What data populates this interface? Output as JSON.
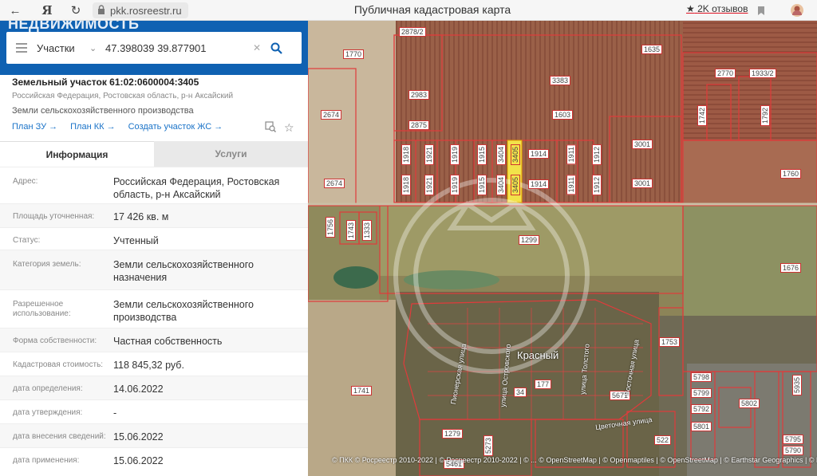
{
  "browser": {
    "url": "pkk.rosreestr.ru",
    "page_title": "Публичная кадастровая карта",
    "reviews": "2K отзывов"
  },
  "panel": {
    "brand": "НЕДВИЖИМОСТЬ",
    "search": {
      "type": "Участки",
      "query": "47.398039 39.877901"
    },
    "plot": {
      "title": "Земельный участок 61:02:0600004:3405",
      "address_short": "Российская Федерация, Ростовская область, р-н Аксайский",
      "category_short": "Земли сельскохозяйственного производства",
      "links": [
        "План ЗУ →",
        "План КК →",
        "Создать участок ЖС →"
      ]
    },
    "tabs": {
      "info": "Информация",
      "services": "Услуги"
    },
    "info": [
      {
        "label": "Адрес:",
        "value": "Российская Федерация, Ростовская область, р-н Аксайский"
      },
      {
        "label": "Площадь уточненная:",
        "value": "17 426 кв. м"
      },
      {
        "label": "Статус:",
        "value": "Учтенный"
      },
      {
        "label": "Категория земель:",
        "value": "Земли сельскохозяйственного назначения"
      },
      {
        "label": "Разрешенное использование:",
        "value": "Земли сельскохозяйственного производства"
      },
      {
        "label": "Форма собственности:",
        "value": "Частная собственность"
      },
      {
        "label": "Кадастровая стоимость:",
        "value": "118 845,32 руб."
      },
      {
        "label": "дата определения:",
        "value": "14.06.2022"
      },
      {
        "label": "дата утверждения:",
        "value": "-"
      },
      {
        "label": "дата внесения сведений:",
        "value": "15.06.2022"
      },
      {
        "label": "дата применения:",
        "value": "15.06.2022"
      }
    ]
  },
  "map": {
    "labels": [
      "2878/2",
      "1770",
      "1635",
      "3383",
      "2770",
      "1933/2",
      "2983",
      "1603",
      "2674",
      "2875",
      "1742",
      "1792",
      "3001",
      "1918",
      "1921",
      "1919",
      "1915",
      "3404",
      "3405",
      "1914",
      "1911",
      "1912",
      "1760",
      "2674",
      "1918",
      "1921",
      "1919",
      "1915",
      "3404",
      "3405",
      "1914",
      "1911",
      "1912",
      "3001",
      "1756",
      "1743",
      "1333",
      "1299",
      "1676",
      "1753",
      "1741",
      "5798",
      "5799",
      "5792",
      "5801",
      "5802",
      "5935",
      "5795",
      "5790",
      "1279",
      "34",
      "177",
      "5273",
      "522",
      "5671",
      "5461"
    ],
    "village": "Красный",
    "streets": [
      "Пионерская улица",
      "улица Островского",
      "улица Толстого",
      "Цветочная улица",
      "Восточная улица"
    ],
    "attribution": "© ПКК © Росреестр 2010-2022 | © Росреестр 2010-2022 | © ... © OpenStreetMap | © Openmaptiles | © OpenStreetMap | © Earthstar Geographics | © Basemap, NASA, NA..."
  }
}
